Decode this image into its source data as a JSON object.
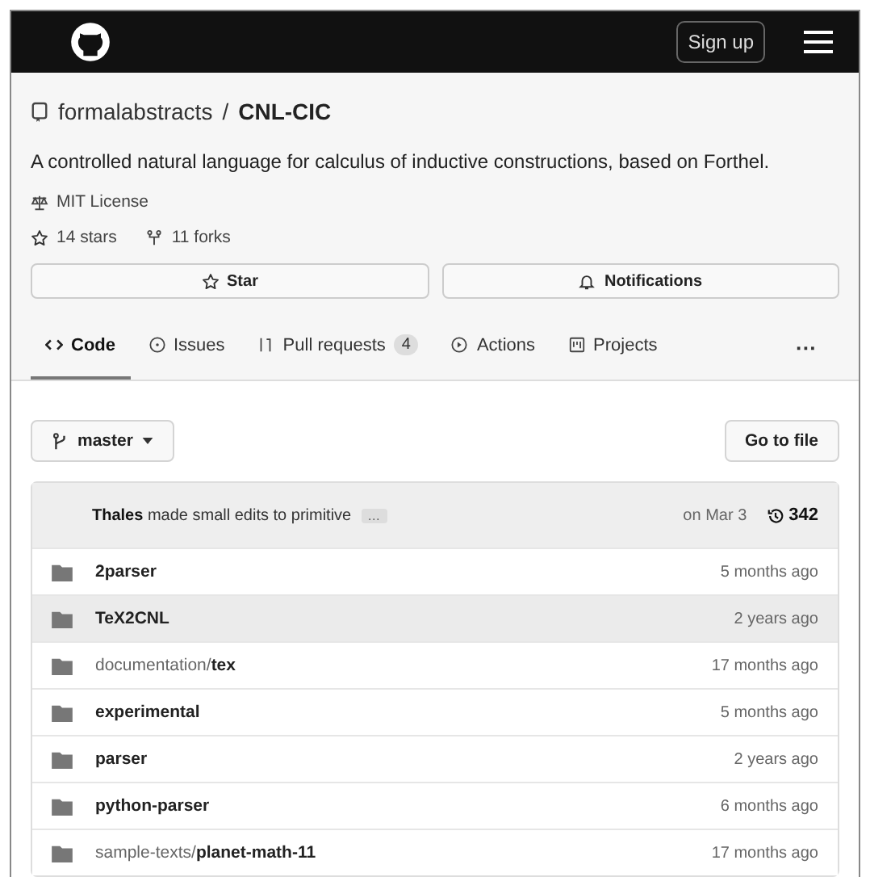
{
  "header": {
    "sign_up": "Sign up"
  },
  "repo": {
    "owner": "formalabstracts",
    "separator": "/",
    "name": "CNL-CIC",
    "description": "A controlled natural language for calculus of inductive constructions, based on Forthel.",
    "license": "MIT License",
    "stars": "14 stars",
    "forks": "11 forks"
  },
  "actions": [
    {
      "kind": "star",
      "label": "Star"
    },
    {
      "kind": "bell",
      "label": "Notifications"
    }
  ],
  "tabs": [
    {
      "kind": "code",
      "label": "Code",
      "selected": true
    },
    {
      "kind": "issue",
      "label": "Issues",
      "selected": false
    },
    {
      "kind": "pull",
      "label": "Pull requests",
      "count": "4",
      "selected": false
    },
    {
      "kind": "play",
      "label": "Actions",
      "selected": false
    },
    {
      "kind": "project",
      "label": "Projects",
      "selected": false
    }
  ],
  "more": "···",
  "branch": "master",
  "go_to_file": "Go to file",
  "commit": {
    "message": "**Thales** made small edits to primitive",
    "ellipsis": "…",
    "date": "on Mar 3",
    "count": "342"
  },
  "files": [
    {
      "name": "2parser",
      "age": "5 months ago",
      "hovered": false
    },
    {
      "name": "TeX2CNL",
      "age": "2 years ago",
      "hovered": true
    },
    {
      "prefix": "documentation/",
      "name": "tex",
      "age": "17 months ago",
      "hovered": false
    },
    {
      "name": "experimental",
      "age": "5 months ago",
      "hovered": false
    },
    {
      "name": "parser",
      "age": "2 years ago",
      "hovered": false
    },
    {
      "name": "python-parser",
      "age": "6 months ago",
      "hovered": false
    },
    {
      "prefix": "sample-texts/",
      "name": "planet-math-11",
      "age": "17 months ago",
      "hovered": false
    }
  ]
}
